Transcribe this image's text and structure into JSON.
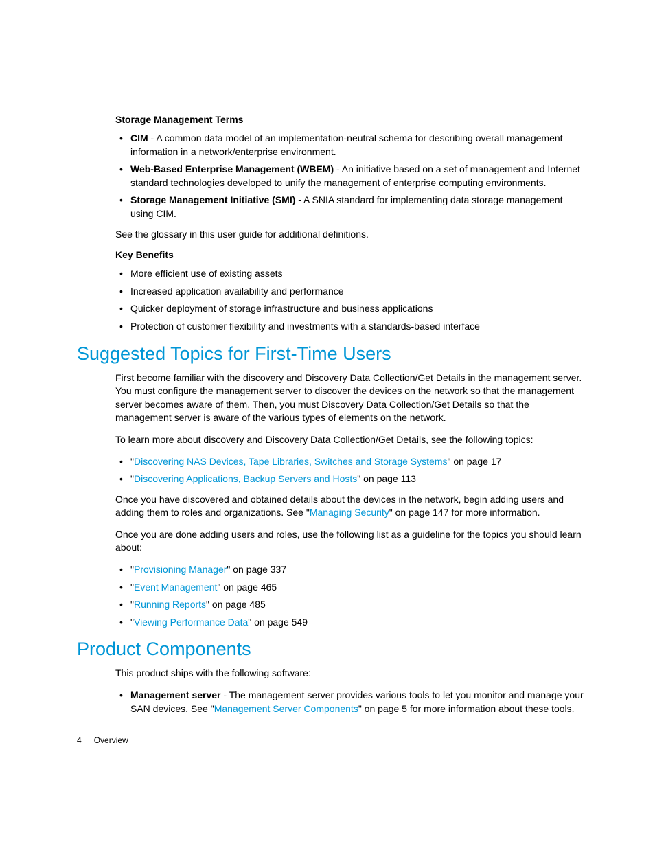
{
  "sec1": {
    "subhead1": "Storage Management Terms",
    "terms": [
      {
        "bold": "CIM",
        "text": " - A common data model of an implementation-neutral schema for describing overall management information in a network/enterprise environment."
      },
      {
        "bold": "Web-Based Enterprise Management (WBEM)",
        "text": " - An initiative based on a set of management and Internet standard technologies developed to unify the management of enterprise computing environments."
      },
      {
        "bold": "Storage Management Initiative (SMI)",
        "text": " - A SNIA standard for implementing data storage management using CIM."
      }
    ],
    "glossary_note": "See the glossary in this user guide for additional definitions.",
    "subhead2": "Key Benefits",
    "benefits": [
      "More efficient use of existing assets",
      "Increased application availability and performance",
      "Quicker deployment of storage infrastructure and business applications",
      "Protection of customer flexibility and investments with a standards-based interface"
    ]
  },
  "sec2": {
    "title": "Suggested Topics for First-Time Users",
    "p1": "First become familiar with the discovery and Discovery Data Collection/Get Details in the management server. You must configure the management server to discover the devices on the network so that the management server becomes aware of them. Then, you must Discovery Data Collection/Get Details so that the management server is aware of the various types of elements on the network.",
    "p2": "To learn more about discovery and Discovery Data Collection/Get Details, see the following topics:",
    "links1": [
      {
        "q1": "\"",
        "link": "Discovering NAS Devices, Tape Libraries, Switches and Storage Systems",
        "tail": "\" on page 17"
      },
      {
        "q1": "\"",
        "link": "Discovering Applications, Backup Servers and Hosts",
        "tail": "\" on page 113"
      }
    ],
    "p3a": "Once you have discovered and obtained details about the devices in the network, begin adding users and adding them to roles and organizations. See \"",
    "p3link": "Managing Security",
    "p3b": "\" on page 147 for more information.",
    "p4": "Once you are done adding users and roles, use the following list as a guideline for the topics you should learn about:",
    "links2": [
      {
        "q1": "\"",
        "link": "Provisioning Manager",
        "tail": "\" on page 337"
      },
      {
        "q1": "\"",
        "link": "Event Management",
        "tail": "\" on page 465"
      },
      {
        "q1": "\"",
        "link": "Running Reports",
        "tail": "\" on page 485"
      },
      {
        "q1": "\"",
        "link": "Viewing Performance Data",
        "tail": "\" on page 549"
      }
    ]
  },
  "sec3": {
    "title": "Product Components",
    "p1": "This product ships with the following software:",
    "item_bold": "Management server",
    "item_a": " - The management server provides various tools to let you monitor and manage your SAN devices. See \"",
    "item_link": "Management Server Components",
    "item_b": "\" on page 5 for more information about these tools."
  },
  "footer": {
    "page": "4",
    "section": "Overview"
  }
}
